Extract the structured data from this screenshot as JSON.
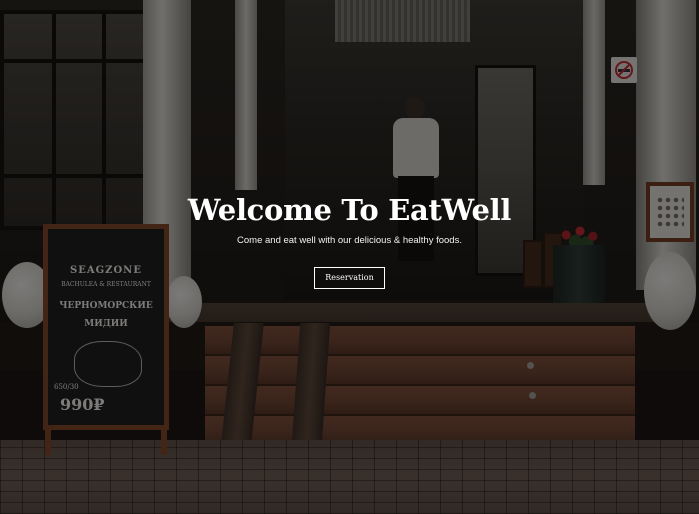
{
  "hero": {
    "title": "Welcome To EatWell",
    "subtitle": "Come and eat well with our delicious & healthy foods.",
    "reservation_label": "Reservation"
  },
  "sign_board": {
    "line_brand": "SEAGZONE",
    "line_type": "BACHULEA & RESTAURANT",
    "line_name": "ЧЕРНОМОРСКИЕ",
    "line_name2": "МИДИИ",
    "line_weight": "650/30",
    "line_price": "990₽"
  },
  "icons": {
    "no_smoking": "no-smoking-icon"
  },
  "colors": {
    "text": "#ffffff",
    "overlay": "rgba(0,0,0,0.46)",
    "board_frame": "#7a4528"
  }
}
